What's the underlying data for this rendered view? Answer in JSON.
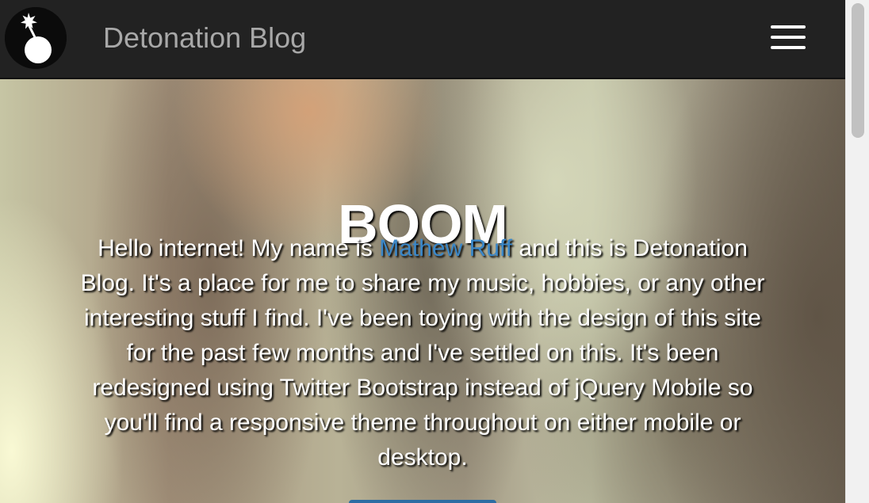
{
  "navbar": {
    "brand": "Detonation Blog",
    "logo_icon": "bomb-icon",
    "menu_icon": "hamburger-menu-icon"
  },
  "hero": {
    "title": "BOOM",
    "intro_before_link": "Hello internet! My name is ",
    "author_link": "Mathew Ruff",
    "intro_after_link": " and this is Detonation Blog. It's a place for me to share my music, hobbies, or any other interesting stuff I find. I've been toying with the design of this site for the past few months and I've settled on this. It's been redesigned using Twitter Bootstrap instead of jQuery Mobile so you'll find a responsive theme throughout on either mobile or desktop."
  },
  "colors": {
    "navbar_background": "#222222",
    "brand_text": "#a8a8a8",
    "link": "#3a87c8",
    "hero_text": "#ffffff",
    "button": "#2d6da3"
  }
}
